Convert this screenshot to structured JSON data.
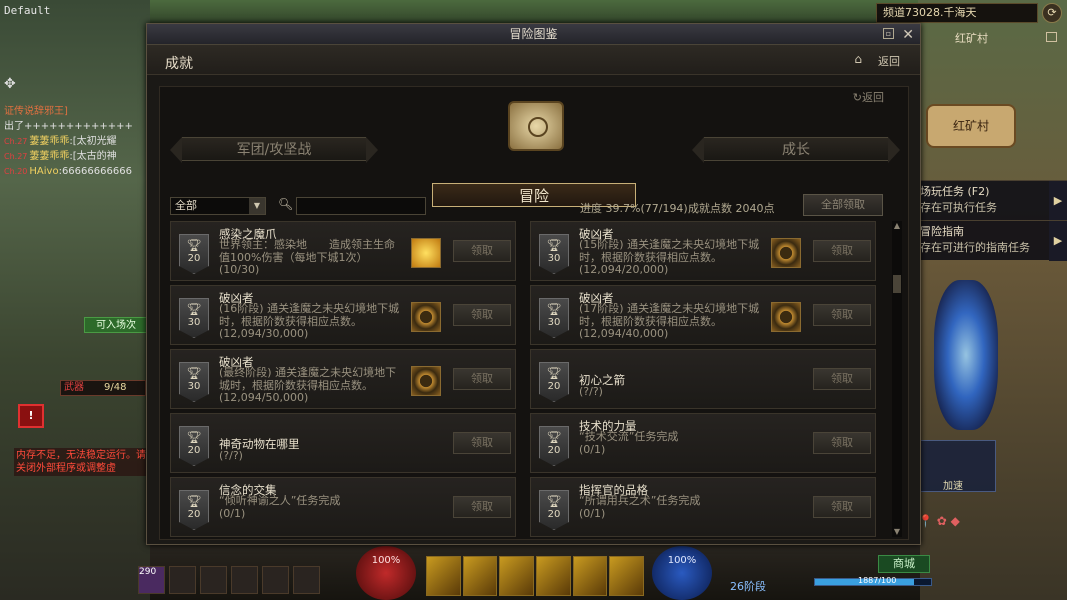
{
  "window": {
    "title": "冒险图鉴"
  },
  "header": {
    "title": "成就",
    "back_label": "返回"
  },
  "inner": {
    "back_label": "返回"
  },
  "tabs": [
    {
      "label": "军团/攻坚战"
    },
    {
      "label": "冒险"
    },
    {
      "label": "成长"
    }
  ],
  "filter": {
    "selected": "全部",
    "search_placeholder": ""
  },
  "progress": {
    "label": "进度",
    "value": "39.7%(77/194)"
  },
  "points": {
    "label": "成就点数",
    "value": "2040点"
  },
  "claim_all_label": "全部领取",
  "claim_label": "领取",
  "achievements": [
    {
      "points": "20",
      "title": "感染之魔爪",
      "desc": "世界领主：感染地　　造成领主生命值100%伤害（每地下城1次）",
      "progress": "(10/30)",
      "icon": "gold"
    },
    {
      "points": "30",
      "title": "破凶者",
      "desc": "(15阶段) 通关逢魔之未央幻境地下城时，根据阶数获得相应点数。",
      "progress": "(12,094/20,000)",
      "icon": "emblem"
    },
    {
      "points": "30",
      "title": "破凶者",
      "desc": "(16阶段) 通关逢魔之未央幻境地下城时，根据阶数获得相应点数。",
      "progress": "(12,094/30,000)",
      "icon": "emblem"
    },
    {
      "points": "30",
      "title": "破凶者",
      "desc": "(17阶段) 通关逢魔之未央幻境地下城时，根据阶数获得相应点数。",
      "progress": "(12,094/40,000)",
      "icon": "emblem"
    },
    {
      "points": "30",
      "title": "破凶者",
      "desc": "(最终阶段) 通关逢魔之未央幻境地下城时，根据阶数获得相应点数。",
      "progress": "(12,094/50,000)",
      "icon": "emblem"
    },
    {
      "points": "20",
      "title": "初心之箭",
      "desc": "",
      "progress": "(?/?)",
      "icon": ""
    },
    {
      "points": "20",
      "title": "神奇动物在哪里",
      "desc": "",
      "progress": "(?/?)",
      "icon": ""
    },
    {
      "points": "20",
      "title": "技术的力量",
      "desc": "“技术交流”任务完成",
      "progress": "(0/1)",
      "icon": ""
    },
    {
      "points": "20",
      "title": "信念的交集",
      "desc": "“倾听神谕之人”任务完成",
      "progress": "(0/1)",
      "icon": ""
    },
    {
      "points": "20",
      "title": "指挥官的品格",
      "desc": "“所谓用兵之术”任务完成",
      "progress": "(0/1)",
      "icon": ""
    }
  ],
  "hud": {
    "default_label": "Default",
    "channel": "频道73028.千海天",
    "map_title": "红矿村",
    "map_location": "红矿村",
    "task1_title": "场玩任务 (F2)",
    "task1_sub": "存在可执行任务",
    "task2_title": "冒险指南",
    "task2_sub": "存在可进行的指南任务",
    "enter_btn": "可入场次",
    "weapon_label": "武器",
    "weapon_value": "9/48",
    "warning": "内存不足，无法稳定运行。请关闭外部程序或调整虚",
    "hp": "100%",
    "mp": "100%",
    "level": "26阶段",
    "shop": "商城",
    "exp_pct": 0.85,
    "exp_label": "1887/100",
    "item_level": "290",
    "accel": "加速"
  },
  "chat": [
    {
      "tag": "",
      "name": "",
      "text": "证传说辞邪王]",
      "kind": "sys"
    },
    {
      "tag": "",
      "name": "",
      "text": "出了+++++++++++++",
      "kind": "txt"
    },
    {
      "tag": "Ch.27",
      "name": "萋萋乖乖",
      "text": ":[太初光耀",
      "kind": "txt"
    },
    {
      "tag": "Ch.27",
      "name": "萋萋乖乖",
      "text": ":[太古的神",
      "kind": "txt"
    },
    {
      "tag": "Ch.20",
      "name": "HAivo",
      "text": ":66666666666",
      "kind": "txt"
    }
  ]
}
